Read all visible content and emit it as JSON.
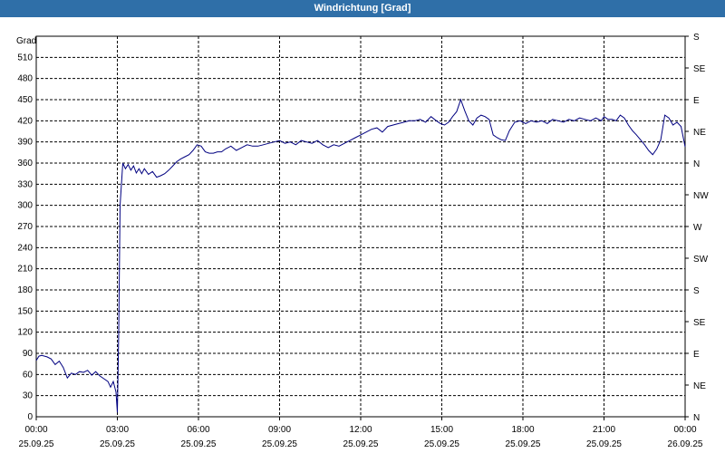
{
  "window_title": "Windrichtung [Grad]",
  "colors": {
    "titlebar": "#2f6fa8",
    "line": "#000080",
    "grid": "#000000"
  },
  "chart_data": {
    "type": "line",
    "title": "Windrichtung [Grad]",
    "ylabel": "Grad",
    "ylim": [
      0,
      540
    ],
    "y_ticks": [
      0,
      30,
      60,
      90,
      120,
      150,
      180,
      210,
      240,
      270,
      300,
      330,
      360,
      390,
      420,
      450,
      480,
      510
    ],
    "right_axis_labels": [
      "N",
      "NE",
      "E",
      "SE",
      "S",
      "SW",
      "W",
      "NW",
      "N",
      "NE",
      "E",
      "SE",
      "S"
    ],
    "x_ticks": [
      {
        "time": "00:00",
        "date": "25.09.25"
      },
      {
        "time": "03:00",
        "date": "25.09.25"
      },
      {
        "time": "06:00",
        "date": "25.09.25"
      },
      {
        "time": "09:00",
        "date": "25.09.25"
      },
      {
        "time": "12:00",
        "date": "25.09.25"
      },
      {
        "time": "15:00",
        "date": "25.09.25"
      },
      {
        "time": "18:00",
        "date": "25.09.25"
      },
      {
        "time": "21:00",
        "date": "25.09.25"
      },
      {
        "time": "00:00",
        "date": "26.09.25"
      }
    ],
    "xlim_hours": [
      0,
      24
    ],
    "grid": true,
    "series": [
      {
        "x_hours": [
          0.0,
          0.1,
          0.2,
          0.4,
          0.55,
          0.7,
          0.85,
          1.0,
          1.15,
          1.3,
          1.45,
          1.6,
          1.75,
          1.9,
          2.05,
          2.2,
          2.35,
          2.5,
          2.65,
          2.75,
          2.85,
          2.95,
          3.0,
          3.05,
          3.1,
          3.2,
          3.3,
          3.4,
          3.5,
          3.6,
          3.7,
          3.8,
          3.9,
          4.0,
          4.15,
          4.3,
          4.45,
          4.6,
          4.75,
          4.9,
          5.05,
          5.2,
          5.35,
          5.5,
          5.65,
          5.8,
          5.95,
          6.1,
          6.25,
          6.4,
          6.55,
          6.7,
          6.85,
          7.0,
          7.2,
          7.4,
          7.6,
          7.8,
          8.0,
          8.2,
          8.4,
          8.6,
          8.8,
          9.0,
          9.2,
          9.4,
          9.6,
          9.8,
          10.0,
          10.2,
          10.4,
          10.6,
          10.8,
          11.0,
          11.2,
          11.4,
          11.6,
          11.8,
          12.0,
          12.2,
          12.4,
          12.6,
          12.8,
          13.0,
          13.2,
          13.4,
          13.6,
          13.8,
          14.0,
          14.2,
          14.4,
          14.6,
          14.8,
          14.95,
          15.1,
          15.25,
          15.4,
          15.55,
          15.7,
          15.85,
          16.0,
          16.15,
          16.3,
          16.45,
          16.6,
          16.75,
          16.9,
          17.05,
          17.2,
          17.35,
          17.5,
          17.7,
          17.9,
          18.1,
          18.3,
          18.5,
          18.7,
          18.9,
          19.1,
          19.3,
          19.5,
          19.7,
          19.9,
          20.1,
          20.3,
          20.5,
          20.7,
          20.9,
          21.0,
          21.15,
          21.3,
          21.45,
          21.6,
          21.75,
          21.9,
          22.05,
          22.2,
          22.35,
          22.5,
          22.65,
          22.8,
          22.95,
          23.1,
          23.25,
          23.4,
          23.55,
          23.7,
          23.85,
          24.0
        ],
        "y": [
          80,
          86,
          87,
          85,
          82,
          74,
          79,
          70,
          55,
          62,
          60,
          64,
          63,
          66,
          59,
          64,
          58,
          54,
          50,
          42,
          50,
          35,
          6,
          120,
          300,
          360,
          352,
          358,
          350,
          356,
          346,
          352,
          345,
          352,
          344,
          348,
          340,
          342,
          345,
          350,
          356,
          362,
          366,
          369,
          372,
          378,
          386,
          384,
          376,
          374,
          374,
          376,
          376,
          380,
          384,
          378,
          382,
          386,
          384,
          384,
          386,
          388,
          390,
          392,
          388,
          390,
          386,
          392,
          390,
          388,
          392,
          386,
          382,
          386,
          384,
          388,
          392,
          396,
          400,
          404,
          408,
          410,
          404,
          412,
          414,
          416,
          418,
          420,
          420,
          422,
          418,
          426,
          420,
          416,
          414,
          418,
          426,
          433,
          450,
          434,
          420,
          414,
          424,
          428,
          426,
          422,
          400,
          396,
          393,
          392,
          406,
          418,
          420,
          416,
          420,
          418,
          420,
          416,
          422,
          420,
          418,
          422,
          420,
          424,
          422,
          420,
          424,
          420,
          426,
          422,
          422,
          420,
          428,
          424,
          414,
          406,
          400,
          393,
          386,
          378,
          372,
          380,
          393,
          428,
          424,
          414,
          418,
          412,
          383
        ]
      }
    ]
  }
}
